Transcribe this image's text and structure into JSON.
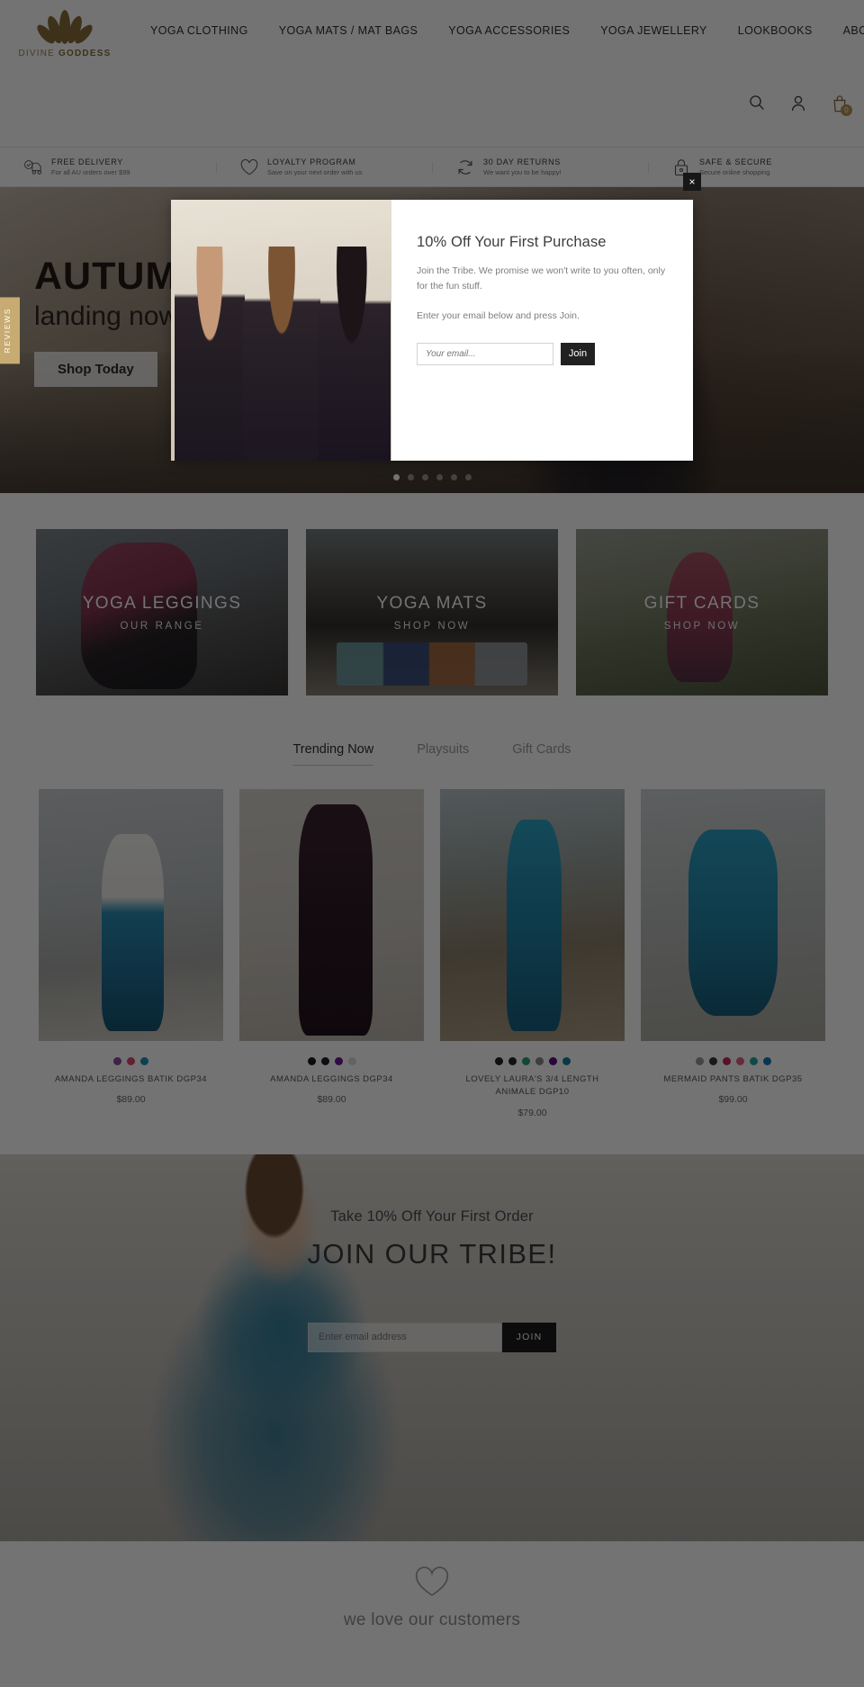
{
  "header": {
    "logo": {
      "word1": "DIVINE",
      "word2": "GODDESS",
      "icon": "lotus-icon"
    },
    "nav": [
      {
        "label": "YOGA CLOTHING"
      },
      {
        "label": "YOGA MATS / MAT BAGS"
      },
      {
        "label": "YOGA ACCESSORIES"
      },
      {
        "label": "YOGA JEWELLERY"
      },
      {
        "label": "LOOKBOOKS"
      },
      {
        "label": "ABOUT"
      }
    ],
    "icons": {
      "search": "search-icon",
      "account": "account-icon",
      "cart": "cart-icon"
    },
    "cart_count": "0"
  },
  "trustbar": [
    {
      "icon": "delivery-truck-icon",
      "title": "FREE DELIVERY",
      "subtitle": "For all AU orders over $99"
    },
    {
      "icon": "heart-icon",
      "title": "LOYALTY PROGRAM",
      "subtitle": "Save on your next order with us"
    },
    {
      "icon": "returns-icon",
      "title": "30 DAY RETURNS",
      "subtitle": "We want you to be happy!"
    },
    {
      "icon": "lock-icon",
      "title": "SAFE & SECURE",
      "subtitle": "Secure online shopping"
    }
  ],
  "hero": {
    "headline": "AUTUMN",
    "subhead": "landing now",
    "cta": "Shop Today",
    "slides": 6,
    "active_slide": 1
  },
  "reviews_tab": {
    "label": "REVIEWS",
    "star": "★"
  },
  "categories": [
    {
      "title": "YOGA LEGGINGS",
      "subtitle": "OUR RANGE"
    },
    {
      "title": "YOGA MATS",
      "subtitle": "SHOP NOW"
    },
    {
      "title": "GIFT CARDS",
      "subtitle": "SHOP NOW"
    }
  ],
  "product_tabs": [
    {
      "label": "Trending Now",
      "active": true
    },
    {
      "label": "Playsuits",
      "active": false
    },
    {
      "label": "Gift Cards",
      "active": false
    }
  ],
  "products": [
    {
      "name": "AMANDA LEGGINGS BATIK DGP34",
      "price": "$89.00",
      "swatches": [
        "#8e4ba0",
        "#d94a6a",
        "#1b8fb5"
      ]
    },
    {
      "name": "AMANDA LEGGINGS DGP34",
      "price": "$89.00",
      "swatches": [
        "#1d1a1f",
        "#241c2b",
        "#6e189a",
        "#dcdcdc"
      ]
    },
    {
      "name": "LOVELY LAURA'S 3/4 LENGTH ANIMALE DGP10",
      "price": "$79.00",
      "swatches": [
        "#272225",
        "#2b2428",
        "#2e9c79",
        "#8a8a8a",
        "#5e0f86",
        "#167c9b"
      ]
    },
    {
      "name": "MERMAID PANTS BATIK DGP35",
      "price": "$99.00",
      "swatches": [
        "#9a9a9a",
        "#3a3340",
        "#c22a52",
        "#e0607f",
        "#22a5a0",
        "#1876b5"
      ]
    }
  ],
  "newsletter": {
    "subheadline": "Take 10% Off Your First Order",
    "headline": "JOIN OUR TRIBE!",
    "email_placeholder": "Enter email address",
    "button": "JOIN"
  },
  "footer_teaser": {
    "icon": "heart-icon",
    "text": "we love our customers"
  },
  "modal": {
    "heading": "10% Off Your First Purchase",
    "paragraph": "Join the Tribe. We promise we won't write to you often, only for the fun stuff.",
    "paragraph2": "Enter your email below and press Join.",
    "email_placeholder": "Your email...",
    "button": "Join",
    "close": "×"
  }
}
